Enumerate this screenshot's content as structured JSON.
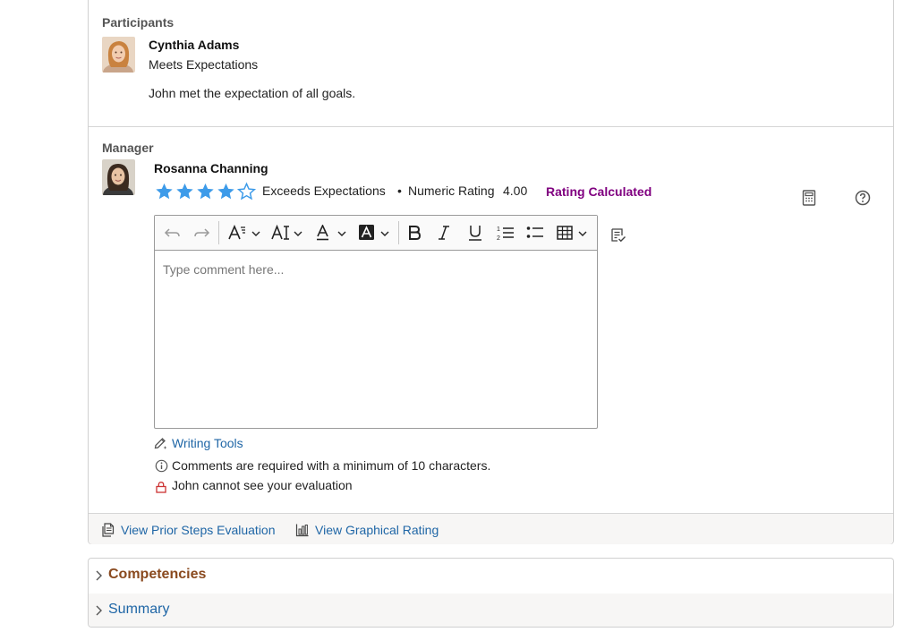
{
  "participants": {
    "section_label": "Participants",
    "name": "Cynthia Adams",
    "rating": "Meets Expectations",
    "comment": "John met the expectation of all goals."
  },
  "manager": {
    "section_label": "Manager",
    "name": "Rosanna Channing",
    "stars_filled": 4,
    "stars_total": 5,
    "rating_label": "Exceeds Expectations",
    "bullet": "•",
    "numeric_rating_label": "Numeric Rating",
    "numeric_rating_value": "4.00",
    "rating_calculated": "Rating Calculated",
    "editor": {
      "placeholder": "Type comment here..."
    },
    "writing_tools": "Writing Tools",
    "required_note": "Comments are required with a minimum of 10 characters.",
    "visibility_note": "John cannot see your evaluation"
  },
  "footer": {
    "prior_steps": "View Prior Steps Evaluation",
    "graphical_rating": "View Graphical Rating"
  },
  "accordions": [
    {
      "label": "Competencies",
      "color": "#8a4a1f"
    },
    {
      "label": "Summary",
      "color": "#1f66a6"
    }
  ],
  "colors": {
    "star": "#3d9be9",
    "link": "#1f66a6",
    "rating_calculated": "#800080",
    "lock": "#cc3333"
  }
}
